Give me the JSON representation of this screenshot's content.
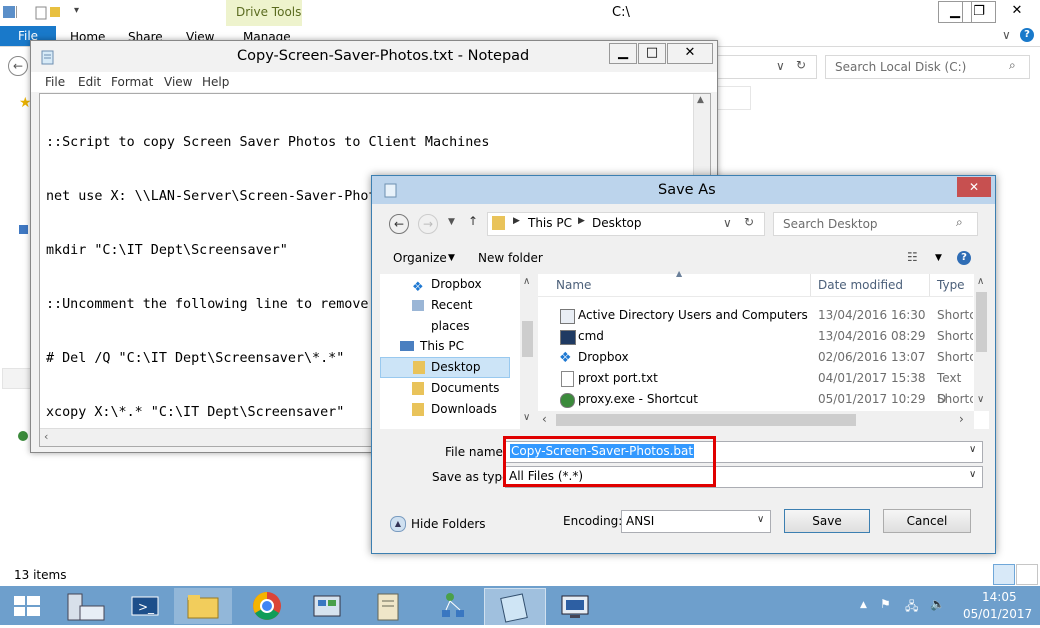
{
  "explorer": {
    "title": "C:\\",
    "contextual_tab": "Drive Tools",
    "tabs": [
      "File",
      "Home",
      "Share",
      "View",
      "Manage"
    ],
    "search_placeholder": "Search Local Disk (C:)",
    "status": "13 items"
  },
  "notepad": {
    "title": "Copy-Screen-Saver-Photos.txt - Notepad",
    "menu": [
      "File",
      "Edit",
      "Format",
      "View",
      "Help"
    ],
    "lines": [
      "::Script to copy Screen Saver Photos to Client Machines",
      "net use X: \\\\LAN-Server\\Screen-Saver-Photos$",
      "mkdir \"C:\\IT Dept\\Screensaver\"",
      "::Uncomment the following line to remove old photos",
      "# Del /Q \"C:\\IT Dept\\Screensaver\\*.*\"",
      "xcopy X:\\*.* \"C:\\IT Dept\\Screensaver\""
    ]
  },
  "saveas": {
    "title": "Save As",
    "breadcrumb": [
      "This PC",
      "Desktop"
    ],
    "search_placeholder": "Search Desktop",
    "organize": "Organize",
    "new_folder": "New folder",
    "nav": [
      {
        "label": "Dropbox",
        "icon": "dropbox-icon"
      },
      {
        "label": "Recent places",
        "icon": "recent-places-icon"
      },
      {
        "label": "This PC",
        "icon": "computer-icon"
      },
      {
        "label": "Desktop",
        "icon": "desktop-folder-icon"
      },
      {
        "label": "Documents",
        "icon": "documents-folder-icon"
      },
      {
        "label": "Downloads",
        "icon": "downloads-folder-icon"
      }
    ],
    "columns": [
      "Name",
      "Date modified",
      "Type"
    ],
    "files": [
      {
        "name": "Active Directory Users and Computers",
        "date": "13/04/2016 16:30",
        "type": "Shortc",
        "icon": "shortcut-icon"
      },
      {
        "name": "cmd",
        "date": "13/04/2016 08:29",
        "type": "Shortc",
        "icon": "cmd-shortcut-icon"
      },
      {
        "name": "Dropbox",
        "date": "02/06/2016 13:07",
        "type": "Shortc",
        "icon": "dropbox-icon"
      },
      {
        "name": "proxt port.txt",
        "date": "04/01/2017 15:38",
        "type": "Text D",
        "icon": "text-file-icon"
      },
      {
        "name": "proxy.exe - Shortcut",
        "date": "05/01/2017 10:29",
        "type": "Shortc",
        "icon": "shortcut-icon"
      }
    ],
    "file_name_label": "File name:",
    "file_name": "Copy-Screen-Saver-Photos.bat",
    "save_type_label": "Save as type:",
    "save_type": "All Files  (*.*)",
    "hide_folders": "Hide Folders",
    "encoding_label": "Encoding:",
    "encoding": "ANSI",
    "save": "Save",
    "cancel": "Cancel",
    "highlight_color": "#e00000"
  },
  "taskbar": {
    "time": "14:05",
    "date": "05/01/2017",
    "apps": [
      "start",
      "server-manager",
      "powershell",
      "file-explorer",
      "chrome",
      "control-panel",
      "script-editor",
      "network",
      "notepad",
      "remote-desktop"
    ]
  }
}
